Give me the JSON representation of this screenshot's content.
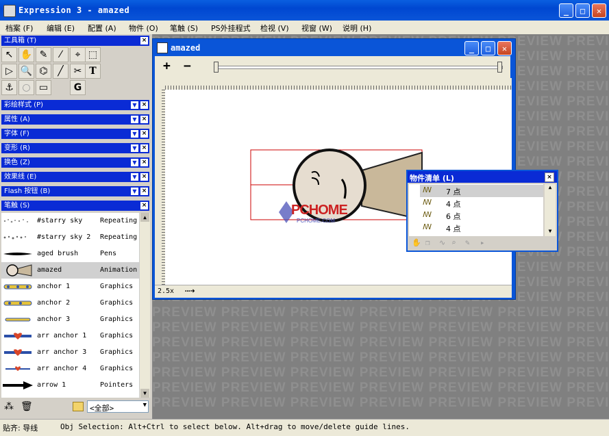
{
  "app": {
    "title": "Expression 3 - amazed"
  },
  "menubar": [
    {
      "label": "档案",
      "key": "(F)"
    },
    {
      "label": "编辑",
      "key": "(E)"
    },
    {
      "label": "配置",
      "key": "(A)"
    },
    {
      "label": "物件",
      "key": "(O)"
    },
    {
      "label": "笔触",
      "key": "(S)"
    },
    {
      "label": "PS外挂程式",
      "key": ""
    },
    {
      "label": "检视",
      "key": "(V)"
    },
    {
      "label": "视窗",
      "key": "(W)"
    },
    {
      "label": "说明",
      "key": "(H)"
    }
  ],
  "panels": {
    "toolbox": "工具箱 (T)",
    "colorstyle": "彩绘样式 (P)",
    "properties": "属性 (A)",
    "font": "字体 (F)",
    "transform": "变形 (R)",
    "colorswap": "换色 (Z)",
    "effectline": "效果线 (E)",
    "flash": "Flash 按钮 (B)",
    "stroke": "笔触 (S)"
  },
  "brushes": [
    {
      "name": "#starry sky",
      "type": "Repeating",
      "icon": "starry-icon"
    },
    {
      "name": "#starry sky 2",
      "type": "Repeating",
      "icon": "starry-icon"
    },
    {
      "name": "aged brush",
      "type": "Pens",
      "icon": "brush-stroke-icon"
    },
    {
      "name": "amazed",
      "type": "Animation",
      "icon": "face-icon"
    },
    {
      "name": "anchor 1",
      "type": "Graphics",
      "icon": "anchor-chain-icon"
    },
    {
      "name": "anchor 2",
      "type": "Graphics",
      "icon": "anchor-chain-icon"
    },
    {
      "name": "anchor 3",
      "type": "Graphics",
      "icon": "anchor-chain-icon"
    },
    {
      "name": "arr anchor 1",
      "type": "Graphics",
      "icon": "heart-arrow-icon"
    },
    {
      "name": "arr anchor 3",
      "type": "Graphics",
      "icon": "heart-arrow-icon"
    },
    {
      "name": "arr anchor 4",
      "type": "Graphics",
      "icon": "heart-arrow-icon"
    },
    {
      "name": "arrow 1",
      "type": "Pointers",
      "icon": "arrow-icon"
    }
  ],
  "brush_filter": "<全部>",
  "document": {
    "title": "amazed",
    "zoom": "2.5x",
    "zoom_in": "+",
    "zoom_out": "−"
  },
  "object_list": {
    "title": "物件清单 (L)",
    "items": [
      "7 点",
      "4 点",
      "6 点",
      "4 点"
    ]
  },
  "watermark": {
    "text": "PREVIEW PREVIEW PREVIEW PREVIEW PREVIEW PREVIEW PREVIEW",
    "logo": "PCHOME",
    "logo_sub": "PCHOME.COM"
  },
  "status": {
    "label": "贴齐: 导线",
    "message": "Obj Selection: Alt+Ctrl to select below. Alt+drag to move/delete guide lines."
  }
}
